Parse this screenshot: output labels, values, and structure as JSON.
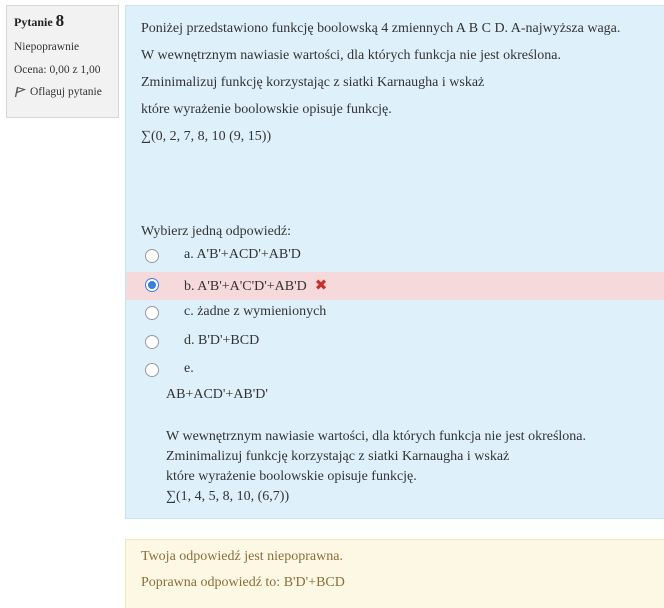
{
  "info": {
    "question_word": "Pytanie",
    "question_number": "8",
    "state": "Niepoprawnie",
    "grade": "Ocena: 0,00 z 1,00",
    "flag_label": "Oflaguj pytanie"
  },
  "question": {
    "lines": [
      "Poniżej przedstawiono funkcję boolowską 4 zmiennych A B C D. A-najwyższa waga.",
      "W wewnętrznym nawiasie wartości, dla których funkcja nie jest określona.",
      "Zminimalizuj funkcję korzystając z siatki Karnaugha i wskaż",
      "które wyrażenie boolowskie opisuje funkcję.",
      "∑(0, 2, 7, 8, 10 (9, 15))"
    ],
    "prompt": "Wybierz jedną odpowiedź:"
  },
  "options": [
    {
      "label": "a. A'B'+ACD'+AB'D",
      "selected": false
    },
    {
      "label": "b. A'B'+A'C'D'+AB'D",
      "selected": true,
      "incorrect": true
    },
    {
      "label": "c. żadne z wymienionych",
      "selected": false
    },
    {
      "label": "d. B'D'+BCD",
      "selected": false
    },
    {
      "label": "e.",
      "selected": false
    }
  ],
  "option_e_text": [
    "AB+ACD'+AB'D'",
    "W wewnętrznym nawiasie wartości, dla których funkcja nie jest określona.",
    "Zminimalizuj funkcję korzystając z siatki Karnaugha i wskaż",
    "które wyrażenie boolowskie opisuje funkcję.",
    "∑(1, 4, 5, 8, 10, (6,7))"
  ],
  "feedback": {
    "line1": "Twoja odpowiedź jest niepoprawna.",
    "line2": "Poprawna odpowiedź to: B'D'+BCD"
  },
  "colors": {
    "content_bg": "#def0fa",
    "incorrect_bg": "#f6d9da",
    "feedback_bg": "#fcf8e3",
    "feedback_text": "#8a6d3b",
    "radio_checked": "#3a7ee0",
    "cross": "#c9302c"
  },
  "icons": {
    "flag": "flag-icon",
    "cross": "incorrect-cross-icon"
  }
}
